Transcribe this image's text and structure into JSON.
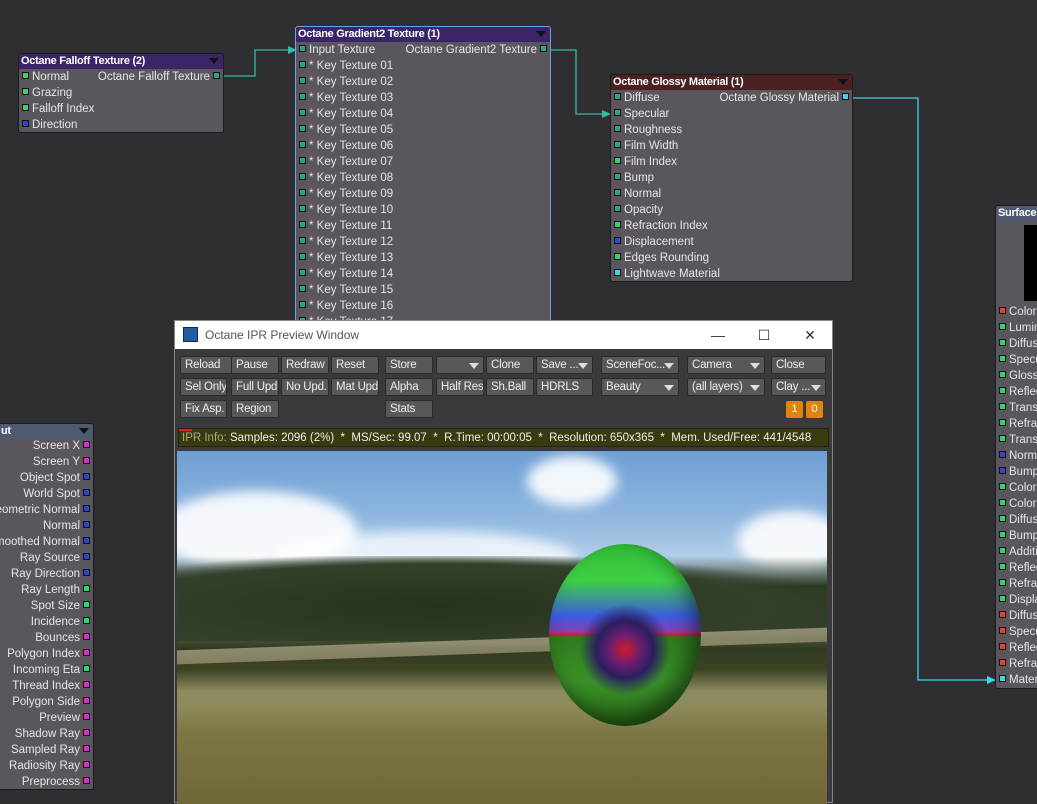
{
  "colors": {
    "green": "#2fd66a",
    "teal": "#2aa58a",
    "blue": "#3045d0",
    "magenta": "#d22ad8",
    "red": "#e0452a",
    "cyan": "#35d8e8",
    "wire": "#2fbfa8",
    "orange": "#e0840f"
  },
  "nodes": {
    "falloff": {
      "title": "Octane Falloff Texture (2)",
      "output": "Octane Falloff Texture",
      "inputs": [
        {
          "label": "Normal",
          "port": "green"
        },
        {
          "label": "Grazing",
          "port": "green"
        },
        {
          "label": "Falloff Index",
          "port": "green"
        },
        {
          "label": "Direction",
          "port": "blue"
        }
      ]
    },
    "gradient": {
      "title": "Octane Gradient2 Texture (1)",
      "output": "Octane Gradient2 Texture",
      "inputs": [
        {
          "label": "Input Texture",
          "port": "teal"
        },
        {
          "label": "* Key Texture 01",
          "port": "teal"
        },
        {
          "label": "* Key Texture 02",
          "port": "teal"
        },
        {
          "label": "* Key Texture 03",
          "port": "teal"
        },
        {
          "label": "* Key Texture 04",
          "port": "teal"
        },
        {
          "label": "* Key Texture 05",
          "port": "teal"
        },
        {
          "label": "* Key Texture 06",
          "port": "teal"
        },
        {
          "label": "* Key Texture 07",
          "port": "teal"
        },
        {
          "label": "* Key Texture 08",
          "port": "teal"
        },
        {
          "label": "* Key Texture 09",
          "port": "teal"
        },
        {
          "label": "* Key Texture 10",
          "port": "teal"
        },
        {
          "label": "* Key Texture 11",
          "port": "teal"
        },
        {
          "label": "* Key Texture 12",
          "port": "teal"
        },
        {
          "label": "* Key Texture 13",
          "port": "teal"
        },
        {
          "label": "* Key Texture 14",
          "port": "teal"
        },
        {
          "label": "* Key Texture 15",
          "port": "teal"
        },
        {
          "label": "* Key Texture 16",
          "port": "teal"
        },
        {
          "label": "* Key Texture 17",
          "port": "teal"
        }
      ]
    },
    "glossy": {
      "title": "Octane Glossy Material (1)",
      "output": "Octane Glossy Material",
      "inputs": [
        {
          "label": "Diffuse",
          "port": "teal"
        },
        {
          "label": "Specular",
          "port": "teal"
        },
        {
          "label": "Roughness",
          "port": "teal"
        },
        {
          "label": "Film Width",
          "port": "teal"
        },
        {
          "label": "Film Index",
          "port": "green"
        },
        {
          "label": "Bump",
          "port": "teal"
        },
        {
          "label": "Normal",
          "port": "teal"
        },
        {
          "label": "Opacity",
          "port": "teal"
        },
        {
          "label": "Refraction Index",
          "port": "green"
        },
        {
          "label": "Displacement",
          "port": "blue"
        },
        {
          "label": "Edges Rounding",
          "port": "green"
        },
        {
          "label": "Lightwave Material",
          "port": "cyan"
        }
      ]
    },
    "surface": {
      "title": "Surface",
      "inputs": [
        {
          "label": "Color",
          "port": "red"
        },
        {
          "label": "Lumin",
          "port": "green"
        },
        {
          "label": "Diffus",
          "port": "green"
        },
        {
          "label": "Specu",
          "port": "green"
        },
        {
          "label": "Glossi",
          "port": "green"
        },
        {
          "label": "Reflec",
          "port": "green"
        },
        {
          "label": "Transp",
          "port": "green"
        },
        {
          "label": "Refrac",
          "port": "green"
        },
        {
          "label": "Transl",
          "port": "green"
        },
        {
          "label": "Norma",
          "port": "blue"
        },
        {
          "label": "Bump",
          "port": "blue"
        },
        {
          "label": "Color",
          "port": "green"
        },
        {
          "label": "Color",
          "port": "green"
        },
        {
          "label": "Diffus",
          "port": "green"
        },
        {
          "label": "Bump",
          "port": "green"
        },
        {
          "label": "Additiv",
          "port": "green"
        },
        {
          "label": "Reflec",
          "port": "green"
        },
        {
          "label": "Refrac",
          "port": "green"
        },
        {
          "label": "Displa",
          "port": "green"
        },
        {
          "label": "Diffus",
          "port": "red"
        },
        {
          "label": "Specu",
          "port": "red"
        },
        {
          "label": "Reflec",
          "port": "red"
        },
        {
          "label": "Refrac",
          "port": "red"
        },
        {
          "label": "Materi",
          "port": "cyan"
        }
      ]
    },
    "input": {
      "title": "ut",
      "outputs": [
        {
          "label": "Screen X",
          "port": "magenta"
        },
        {
          "label": "Screen Y",
          "port": "magenta"
        },
        {
          "label": "Object Spot",
          "port": "blue"
        },
        {
          "label": "World Spot",
          "port": "blue"
        },
        {
          "label": "Geometric Normal",
          "port": "blue"
        },
        {
          "label": "Normal",
          "port": "blue"
        },
        {
          "label": "Smoothed Normal",
          "port": "blue"
        },
        {
          "label": "Ray Source",
          "port": "blue"
        },
        {
          "label": "Ray Direction",
          "port": "blue"
        },
        {
          "label": "Ray Length",
          "port": "green"
        },
        {
          "label": "Spot Size",
          "port": "green"
        },
        {
          "label": "Incidence",
          "port": "green"
        },
        {
          "label": "Bounces",
          "port": "magenta"
        },
        {
          "label": "Polygon Index",
          "port": "magenta"
        },
        {
          "label": "Incoming Eta",
          "port": "green"
        },
        {
          "label": "Thread Index",
          "port": "magenta"
        },
        {
          "label": "Polygon Side",
          "port": "magenta"
        },
        {
          "label": "Preview",
          "port": "magenta"
        },
        {
          "label": "Shadow Ray",
          "port": "magenta"
        },
        {
          "label": "Sampled Ray",
          "port": "magenta"
        },
        {
          "label": "Radiosity Ray",
          "port": "magenta"
        },
        {
          "label": "Preprocess",
          "port": "magenta"
        }
      ]
    }
  },
  "ipr": {
    "title": "Octane IPR Preview Window",
    "controls": {
      "minimize": "—",
      "maximize": "☐",
      "close": "✕"
    },
    "buttons": [
      {
        "label": "Reload",
        "name": "reload"
      },
      {
        "label": "Pause",
        "name": "pause"
      },
      {
        "label": "Redraw",
        "name": "redraw"
      },
      {
        "label": "Reset",
        "name": "reset"
      },
      {
        "label": "Store",
        "name": "store"
      },
      {
        "label": "",
        "name": "store-slot",
        "dropdown": true
      },
      {
        "label": "Clone",
        "name": "clone"
      },
      {
        "label": "Save ...",
        "name": "save",
        "dropdown": true
      },
      {
        "label": "SceneFoc...",
        "name": "scene-focus",
        "dropdown": true
      },
      {
        "label": "Camera",
        "name": "camera",
        "dropdown": true
      },
      {
        "label": "Close",
        "name": "close"
      },
      {
        "label": "Sel Only",
        "name": "sel-only"
      },
      {
        "label": "Full Upd.",
        "name": "full-update"
      },
      {
        "label": "No Upd.",
        "name": "no-update"
      },
      {
        "label": "Mat Upd",
        "name": "mat-update"
      },
      {
        "label": "Alpha",
        "name": "alpha"
      },
      {
        "label": "Half Res",
        "name": "half-res"
      },
      {
        "label": "Sh.Ball",
        "name": "sh-ball"
      },
      {
        "label": "HDRLS",
        "name": "hdrls"
      },
      {
        "label": "Beauty",
        "name": "beauty",
        "dropdown": true
      },
      {
        "label": "(all layers)",
        "name": "layers",
        "dropdown": true
      },
      {
        "label": "Clay ...",
        "name": "clay",
        "dropdown": true
      },
      {
        "label": "Fix Asp.",
        "name": "fix-aspect"
      },
      {
        "label": "Region",
        "name": "region"
      },
      {
        "label": "Stats",
        "name": "stats"
      }
    ],
    "counters": [
      "1",
      "0"
    ],
    "info": {
      "label": "IPR Info:",
      "text": "Samples: 2096 (2%)  *  MS/Sec: 99.07  *  R.Time: 00:00:05  *  Resolution: 650x365  *  Mem. Used/Free: 441/4548",
      "progress_percent": 2
    }
  }
}
